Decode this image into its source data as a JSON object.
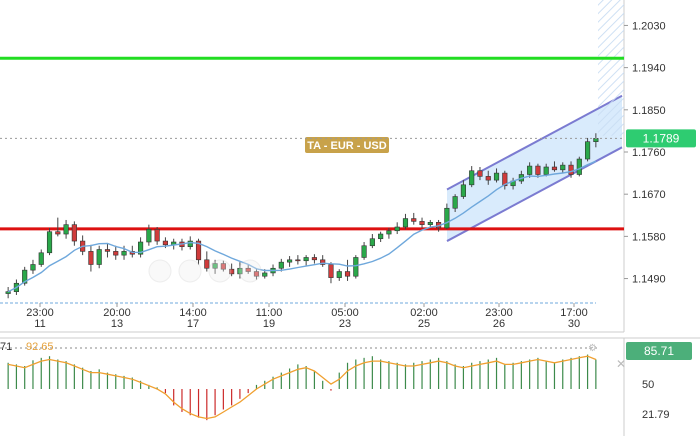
{
  "chart_data": [
    {
      "type": "candlestick",
      "watermark": "TA - EUR - USD",
      "price_axis": {
        "ticks": [
          "1.2030",
          "1.1940",
          "1.1850",
          "1.1760",
          "1.1670",
          "1.1580",
          "1.1490"
        ],
        "ylim": [
          1.144,
          1.208
        ]
      },
      "current_price": {
        "label": "1.1789",
        "value": 1.1789,
        "color": "#2ecc71"
      },
      "time_axis": {
        "labels": [
          {
            "time": "23:00",
            "date": "11"
          },
          {
            "time": "20:00",
            "date": "13"
          },
          {
            "time": "14:00",
            "date": "17"
          },
          {
            "time": "11:00",
            "date": "19"
          },
          {
            "time": "05:00",
            "date": "23"
          },
          {
            "time": "02:00",
            "date": "25"
          },
          {
            "time": "23:00",
            "date": "26"
          },
          {
            "time": "17:00",
            "date": "30"
          }
        ]
      },
      "levels": [
        {
          "value": 1.196,
          "color": "#22dd22"
        },
        {
          "value": 1.1596,
          "color": "#dd1111"
        }
      ],
      "candles": [
        [
          1.1458,
          1.1472,
          1.1448,
          1.1462
        ],
        [
          1.1462,
          1.1488,
          1.1455,
          1.148
        ],
        [
          1.148,
          1.1515,
          1.1475,
          1.1508
        ],
        [
          1.1508,
          1.153,
          1.15,
          1.152
        ],
        [
          1.152,
          1.1552,
          1.1515,
          1.1545
        ],
        [
          1.1545,
          1.1598,
          1.154,
          1.159
        ],
        [
          1.159,
          1.162,
          1.158,
          1.1585
        ],
        [
          1.1585,
          1.1615,
          1.1575,
          1.1605
        ],
        [
          1.1605,
          1.1612,
          1.156,
          1.157
        ],
        [
          1.157,
          1.1582,
          1.154,
          1.1548
        ],
        [
          1.1548,
          1.1562,
          1.1505,
          1.152
        ],
        [
          1.152,
          1.156,
          1.1512,
          1.1552
        ],
        [
          1.1552,
          1.1565,
          1.1535,
          1.1548
        ],
        [
          1.1548,
          1.156,
          1.153,
          1.154
        ],
        [
          1.154,
          1.156,
          1.153,
          1.1548
        ],
        [
          1.1548,
          1.156,
          1.1535,
          1.1542
        ],
        [
          1.1542,
          1.1578,
          1.1535,
          1.1568
        ],
        [
          1.1568,
          1.1605,
          1.156,
          1.1595
        ],
        [
          1.1595,
          1.16,
          1.1562,
          1.157
        ],
        [
          1.157,
          1.1578,
          1.1555,
          1.1562
        ],
        [
          1.1562,
          1.1575,
          1.1552,
          1.1568
        ],
        [
          1.1568,
          1.1575,
          1.155,
          1.1558
        ],
        [
          1.1558,
          1.158,
          1.1552,
          1.157
        ],
        [
          1.157,
          1.1575,
          1.152,
          1.153
        ],
        [
          1.153,
          1.1548,
          1.1505,
          1.1512
        ],
        [
          1.1512,
          1.153,
          1.15,
          1.1522
        ],
        [
          1.1522,
          1.1528,
          1.1505,
          1.151
        ],
        [
          1.151,
          1.1522,
          1.1495,
          1.15
        ],
        [
          1.15,
          1.1525,
          1.149,
          1.1512
        ],
        [
          1.1512,
          1.152,
          1.15,
          1.1505
        ],
        [
          1.1505,
          1.1512,
          1.1488,
          1.1495
        ],
        [
          1.1495,
          1.151,
          1.149,
          1.1502
        ],
        [
          1.1502,
          1.152,
          1.1495,
          1.1512
        ],
        [
          1.1512,
          1.1532,
          1.1505,
          1.1525
        ],
        [
          1.1525,
          1.1538,
          1.1515,
          1.153
        ],
        [
          1.153,
          1.154,
          1.152,
          1.1528
        ],
        [
          1.1528,
          1.154,
          1.1518,
          1.1535
        ],
        [
          1.1535,
          1.1542,
          1.1522,
          1.153
        ],
        [
          1.153,
          1.154,
          1.1515,
          1.152
        ],
        [
          1.152,
          1.1525,
          1.148,
          1.1492
        ],
        [
          1.1492,
          1.151,
          1.1485,
          1.1505
        ],
        [
          1.1505,
          1.153,
          1.1485,
          1.1495
        ],
        [
          1.1495,
          1.154,
          1.149,
          1.1535
        ],
        [
          1.1535,
          1.1568,
          1.153,
          1.156
        ],
        [
          1.156,
          1.1585,
          1.1555,
          1.1575
        ],
        [
          1.1575,
          1.159,
          1.1568,
          1.1585
        ],
        [
          1.1585,
          1.1598,
          1.1575,
          1.1592
        ],
        [
          1.1592,
          1.161,
          1.1585,
          1.16
        ],
        [
          1.16,
          1.1628,
          1.1595,
          1.1618
        ],
        [
          1.1618,
          1.163,
          1.1605,
          1.1612
        ],
        [
          1.1612,
          1.162,
          1.1598,
          1.1605
        ],
        [
          1.1605,
          1.1615,
          1.1598,
          1.161
        ],
        [
          1.161,
          1.1615,
          1.159,
          1.1598
        ],
        [
          1.1598,
          1.165,
          1.1595,
          1.164
        ],
        [
          1.164,
          1.167,
          1.1632,
          1.1665
        ],
        [
          1.1665,
          1.17,
          1.166,
          1.169
        ],
        [
          1.169,
          1.173,
          1.1685,
          1.172
        ],
        [
          1.172,
          1.1728,
          1.17,
          1.1708
        ],
        [
          1.1708,
          1.172,
          1.169,
          1.17
        ],
        [
          1.17,
          1.1725,
          1.1695,
          1.1715
        ],
        [
          1.1715,
          1.172,
          1.168,
          1.1688
        ],
        [
          1.1688,
          1.1705,
          1.168,
          1.1698
        ],
        [
          1.1698,
          1.172,
          1.1692,
          1.1712
        ],
        [
          1.1712,
          1.1738,
          1.1705,
          1.173
        ],
        [
          1.173,
          1.1735,
          1.1705,
          1.1712
        ],
        [
          1.1712,
          1.1735,
          1.1708,
          1.1728
        ],
        [
          1.1728,
          1.174,
          1.1718,
          1.1722
        ],
        [
          1.1722,
          1.1738,
          1.1715,
          1.1732
        ],
        [
          1.1732,
          1.174,
          1.1705,
          1.1712
        ],
        [
          1.1712,
          1.175,
          1.1708,
          1.1745
        ],
        [
          1.1745,
          1.179,
          1.174,
          1.1782
        ],
        [
          1.1782,
          1.18,
          1.177,
          1.1789
        ]
      ],
      "moving_average": {
        "color": "#6fa8dc"
      },
      "channel": {
        "upper_start": 1.168,
        "upper_end": 1.188,
        "lower_start": 1.157,
        "lower_end": 1.177
      },
      "oscillator": {
        "period_label": "71",
        "value_label": "92.65",
        "current_label": "85.71",
        "ticks": [
          "50",
          "21.79"
        ],
        "ylim": [
          0,
          100
        ],
        "bar_values": [
          82,
          80,
          78,
          85,
          88,
          90,
          86,
          84,
          80,
          76,
          72,
          74,
          70,
          68,
          66,
          64,
          60,
          55,
          52,
          45,
          30,
          22,
          18,
          15,
          12,
          18,
          25,
          30,
          38,
          45,
          55,
          60,
          65,
          70,
          75,
          80,
          78,
          72,
          60,
          48,
          70,
          82,
          86,
          88,
          90,
          86,
          84,
          82,
          80,
          82,
          84,
          86,
          88,
          84,
          80,
          78,
          82,
          84,
          86,
          88,
          80,
          82,
          84,
          86,
          88,
          84,
          82,
          86,
          88,
          90,
          92,
          86
        ],
        "line_values": [
          80,
          78,
          76,
          80,
          84,
          86,
          84,
          82,
          78,
          74,
          70,
          70,
          68,
          66,
          64,
          62,
          58,
          54,
          50,
          44,
          34,
          26,
          20,
          16,
          14,
          16,
          22,
          28,
          34,
          42,
          50,
          56,
          62,
          66,
          70,
          74,
          76,
          72,
          64,
          56,
          62,
          72,
          78,
          82,
          84,
          84,
          82,
          80,
          78,
          78,
          80,
          82,
          84,
          82,
          78,
          76,
          78,
          80,
          82,
          84,
          80,
          80,
          82,
          84,
          86,
          84,
          82,
          84,
          86,
          88,
          90,
          86
        ]
      }
    }
  ]
}
